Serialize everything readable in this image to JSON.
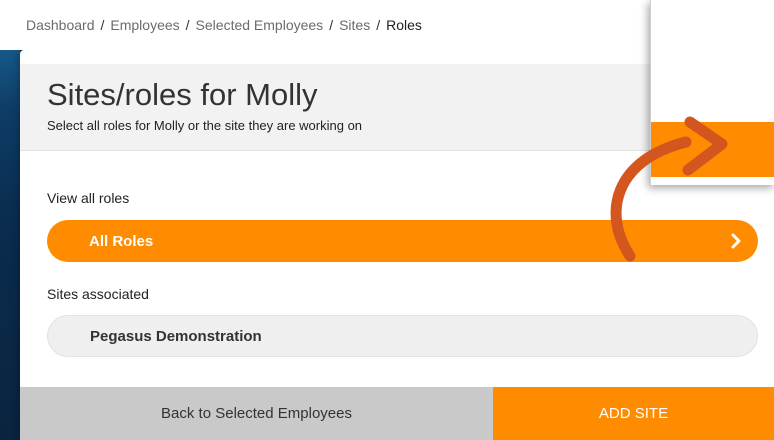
{
  "breadcrumb": {
    "items": [
      "Dashboard",
      "Employees",
      "Selected Employees",
      "Sites"
    ],
    "separator": "/",
    "current": "Roles"
  },
  "header": {
    "title": "Sites/roles for Molly",
    "subtitle": "Select all roles for Molly or the site they are working on"
  },
  "roles_section": {
    "label": "View all roles",
    "button_label": "All Roles",
    "icon": "chevron-right-icon"
  },
  "sites_section": {
    "label": "Sites associated",
    "items": [
      "Pegasus Demonstration"
    ]
  },
  "footer": {
    "back_label": "Back to Selected Employees",
    "add_label": "ADD SITE"
  },
  "colors": {
    "accent": "#ff8c00",
    "arrow": "#d2561d",
    "footer_grey": "#c9c9c9",
    "pill_grey": "#efefef"
  }
}
